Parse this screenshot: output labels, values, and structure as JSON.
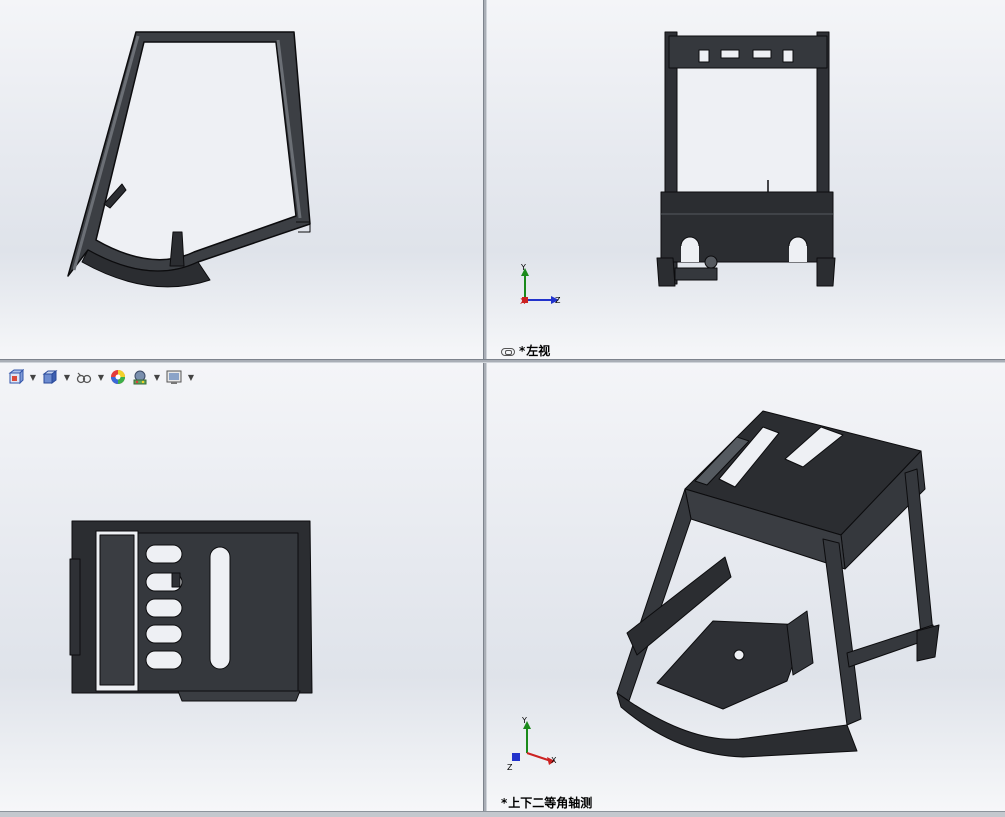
{
  "viewports": {
    "top_left": {},
    "top_right": {
      "label_star": "*",
      "label": "左视",
      "triad": {
        "y": "Y",
        "z": "Z",
        "x": "X"
      }
    },
    "bottom_left": {
      "toolbar": [
        {
          "icon": "view-orientation-icon"
        },
        {
          "icon": "display-style-icon"
        },
        {
          "icon": "hide-show-items-icon"
        },
        {
          "icon": "edit-appearance-icon"
        },
        {
          "icon": "apply-scene-icon"
        },
        {
          "icon": "view-settings-icon"
        }
      ]
    },
    "bottom_right": {
      "label_star": "*",
      "label": "上下二等角轴测",
      "triad": {
        "y": "Y",
        "x": "X",
        "z": "Z"
      }
    }
  },
  "colors": {
    "model_dark": "#2b2d31",
    "model_mid": "#45484d",
    "model_edge": "#0c0c0e",
    "axis_y": "#1a8a1a",
    "axis_z": "#2233cc",
    "axis_x": "#cc2222"
  }
}
